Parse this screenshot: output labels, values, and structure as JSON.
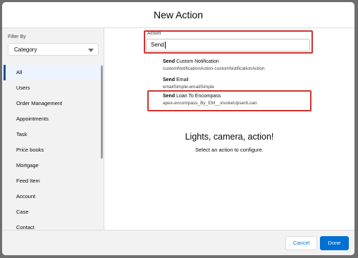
{
  "header": {
    "title": "New Action"
  },
  "sidebar": {
    "filter_label": "Filter By",
    "filter_value": "Category",
    "items": [
      {
        "label": "All"
      },
      {
        "label": "Users"
      },
      {
        "label": "Order Management"
      },
      {
        "label": "Appointments"
      },
      {
        "label": "Task"
      },
      {
        "label": "Price books"
      },
      {
        "label": "Mortgage"
      },
      {
        "label": "Feed Item"
      },
      {
        "label": "Account"
      },
      {
        "label": "Case"
      },
      {
        "label": "Contact"
      }
    ],
    "active_index": 0
  },
  "main": {
    "action_label": "Action",
    "action_value": "Send",
    "options": [
      {
        "bold": "Send",
        "rest": " Custom Notification",
        "sub": "customNotificationAction-customNotificationAction"
      },
      {
        "bold": "Send",
        "rest": " Email",
        "sub": "emailSimple-emailSimple"
      },
      {
        "bold": "Send",
        "rest": " Loan To Encompass",
        "sub": "apex-encompass_By_EM__invokeUpsertLoan"
      }
    ],
    "empty_title": "Lights, camera, action!",
    "empty_subtitle": "Select an action to configure."
  },
  "footer": {
    "cancel_label": "Cancel",
    "done_label": "Done"
  },
  "colors": {
    "brand": "#0070d2",
    "highlight": "#d0312d",
    "active_bar": "#1b5297"
  },
  "icons": {
    "filter_dropdown": "chevron-down-icon"
  }
}
